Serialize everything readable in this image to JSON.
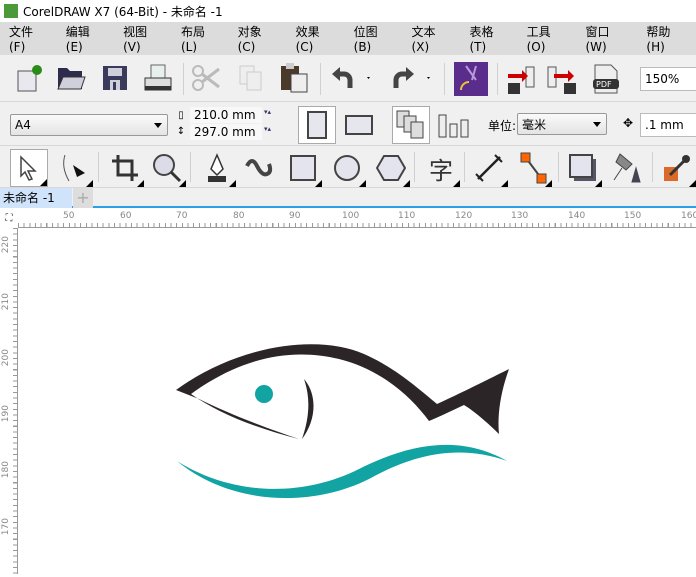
{
  "titlebar": {
    "title": "CorelDRAW X7 (64-Bit) - 未命名 -1"
  },
  "menu": [
    "文件(F)",
    "编辑(E)",
    "视图(V)",
    "布局(L)",
    "对象(C)",
    "效果(C)",
    "位图(B)",
    "文本(X)",
    "表格(T)",
    "工具(O)",
    "窗口(W)",
    "帮助(H)"
  ],
  "toolbar": {
    "zoom": "150%"
  },
  "property_bar": {
    "page_size": "A4",
    "width": "210.0 mm",
    "height": "297.0 mm",
    "unit_label": "单位:",
    "unit": "毫米",
    "nudge": ".1 mm"
  },
  "toolbox": {
    "text_tool": "字"
  },
  "document_tab": {
    "label": "未命名 -1",
    "add": "+"
  },
  "ruler": {
    "h": [
      "50",
      "60",
      "70",
      "80",
      "90",
      "100",
      "110",
      "120",
      "130",
      "140",
      "150",
      "160"
    ],
    "v": [
      "220",
      "210",
      "200",
      "190",
      "180",
      "170"
    ]
  },
  "colors": {
    "fish_dark": "#2b2528",
    "fish_teal": "#12a3a3"
  }
}
